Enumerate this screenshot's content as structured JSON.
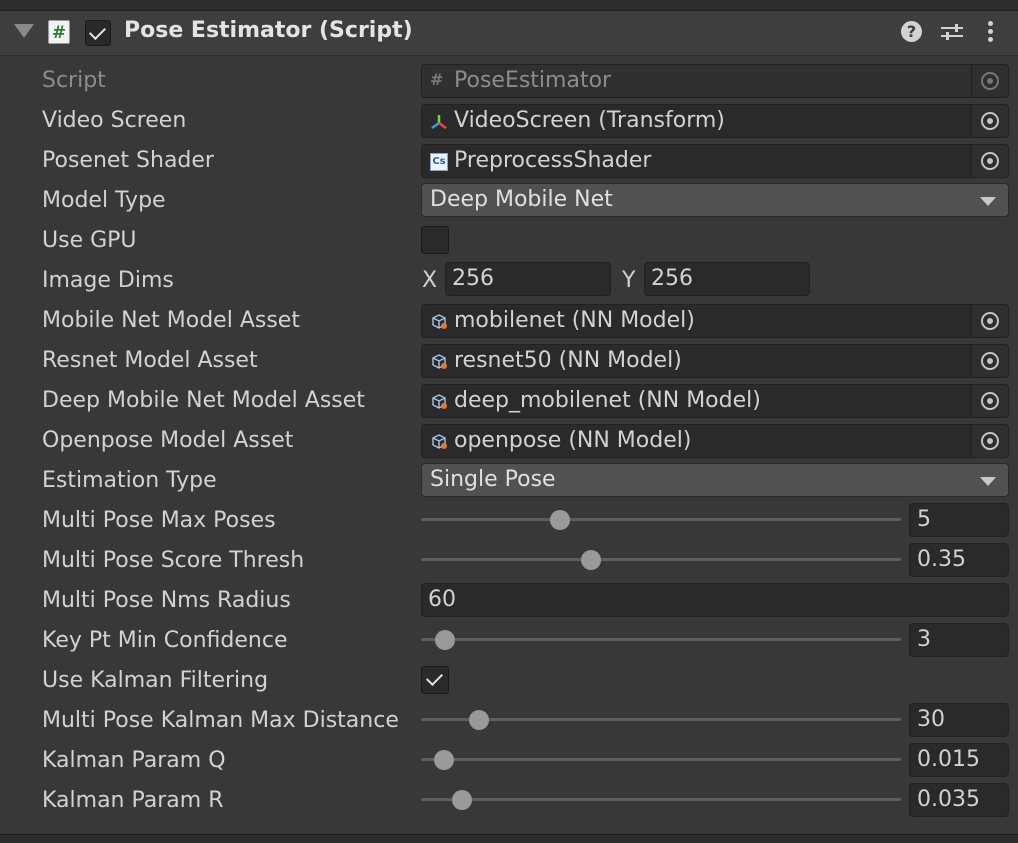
{
  "component": {
    "title": "Pose Estimator (Script)",
    "enabled": true,
    "icon": "script-hash-icon"
  },
  "header_icons": [
    "help-icon",
    "presets-icon",
    "kebab-menu-icon"
  ],
  "fields": {
    "script": {
      "label": "Script",
      "value": "PoseEstimator",
      "icon": "script-hash-icon"
    },
    "video_screen": {
      "label": "Video Screen",
      "value": "VideoScreen (Transform)",
      "icon": "transform-axes-icon"
    },
    "posenet_shader": {
      "label": "Posenet Shader",
      "value": "PreprocessShader",
      "icon": "compute-shader-icon",
      "icon_text": "Cs"
    },
    "model_type": {
      "label": "Model Type",
      "value": "Deep Mobile Net"
    },
    "use_gpu": {
      "label": "Use GPU",
      "checked": false
    },
    "image_dims": {
      "label": "Image Dims",
      "x_label": "X",
      "x_value": "256",
      "y_label": "Y",
      "y_value": "256"
    },
    "mobile_net_model": {
      "label": "Mobile Net Model Asset",
      "value": "mobilenet (NN Model)",
      "icon": "nn-model-icon"
    },
    "resnet_model": {
      "label": "Resnet Model Asset",
      "value": "resnet50 (NN Model)",
      "icon": "nn-model-icon"
    },
    "deep_mobile_net_model": {
      "label": "Deep Mobile Net Model Asset",
      "value": "deep_mobilenet (NN Model)",
      "icon": "nn-model-icon"
    },
    "openpose_model": {
      "label": "Openpose Model Asset",
      "value": "openpose (NN Model)",
      "icon": "nn-model-icon"
    },
    "estimation_type": {
      "label": "Estimation Type",
      "value": "Single Pose"
    },
    "multi_pose_max_poses": {
      "label": "Multi Pose Max Poses",
      "value": "5",
      "slider_fraction": 0.29
    },
    "multi_pose_score_thresh": {
      "label": "Multi Pose Score Thresh",
      "value": "0.35",
      "slider_fraction": 0.355
    },
    "multi_pose_nms_radius": {
      "label": "Multi Pose Nms Radius",
      "value": "60"
    },
    "key_pt_min_confidence": {
      "label": "Key Pt Min Confidence",
      "value": "3",
      "slider_fraction": 0.05
    },
    "use_kalman_filtering": {
      "label": "Use Kalman Filtering",
      "checked": true
    },
    "multi_pose_kalman_max_distance": {
      "label": "Multi Pose Kalman Max Distance",
      "value": "30",
      "slider_fraction": 0.12
    },
    "kalman_param_q": {
      "label": "Kalman Param Q",
      "value": "0.015",
      "slider_fraction": 0.048
    },
    "kalman_param_r": {
      "label": "Kalman Param R",
      "value": "0.035",
      "slider_fraction": 0.085
    }
  }
}
